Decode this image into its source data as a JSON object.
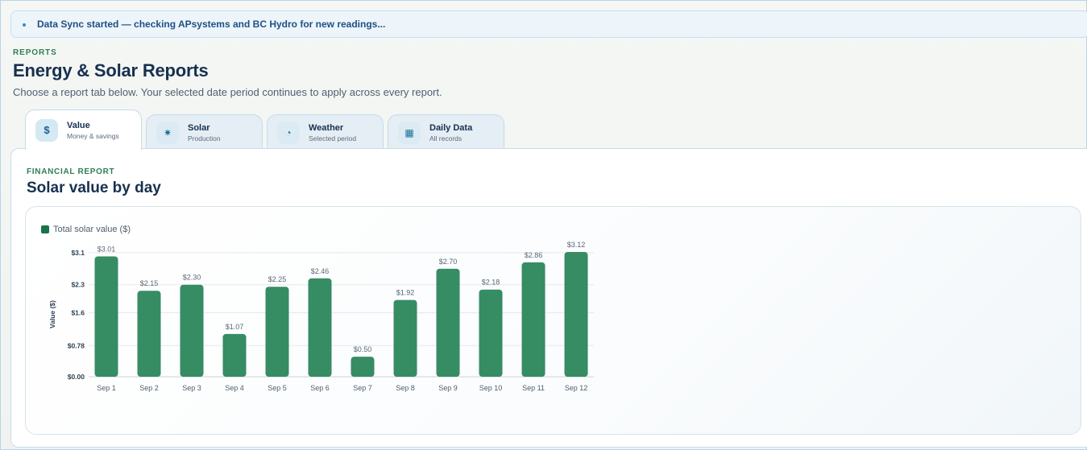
{
  "sync_banner": {
    "text": "Data Sync started — checking APsystems and BC Hydro for new readings..."
  },
  "header": {
    "eyebrow": "REPORTS",
    "title": "Energy & Solar Reports",
    "subtitle": "Choose a report tab below. Your selected date period continues to apply across every report."
  },
  "tabs": [
    {
      "label": "Value",
      "sub": "Money & savings",
      "icon": "dollar-icon",
      "glyph": "$",
      "active": true
    },
    {
      "label": "Solar",
      "sub": "Production",
      "icon": "sun-icon",
      "glyph": "✷",
      "active": false
    },
    {
      "label": "Weather",
      "sub": "Selected period",
      "icon": "weather-icon",
      "glyph": "◔",
      "active": false
    },
    {
      "label": "Daily Data",
      "sub": "All records",
      "icon": "grid-icon",
      "glyph": "▦",
      "active": false
    }
  ],
  "panel": {
    "eyebrow": "FINANCIAL REPORT",
    "title": "Solar value by day"
  },
  "colors": {
    "bar": "#368c63",
    "legend": "#17744a",
    "accent_green": "#2f7f52"
  },
  "chart_data": {
    "type": "bar",
    "categories": [
      "Sep 1",
      "Sep 2",
      "Sep 3",
      "Sep 4",
      "Sep 5",
      "Sep 6",
      "Sep 7",
      "Sep 8",
      "Sep 9",
      "Sep 10",
      "Sep 11",
      "Sep 12"
    ],
    "series": [
      {
        "name": "Total solar value ($)",
        "values": [
          3.01,
          2.15,
          2.3,
          1.07,
          2.25,
          2.46,
          0.5,
          1.92,
          2.7,
          2.18,
          2.86,
          3.12
        ]
      }
    ],
    "data_labels": [
      "$3.01",
      "$2.15",
      "$2.30",
      "$1.07",
      "$2.25",
      "$2.46",
      "$0.50",
      "$1.92",
      "$2.70",
      "$2.18",
      "$2.86",
      "$3.12"
    ],
    "ylabel": "Value ($)",
    "y_ticks": [
      0,
      0.78,
      1.6,
      2.3,
      3.1
    ],
    "y_tick_labels": [
      "$0.00",
      "$0.78",
      "$1.6",
      "$2.3",
      "$3.1"
    ],
    "ylim": [
      0,
      3.12
    ],
    "grid": true,
    "legend": "top-left"
  }
}
